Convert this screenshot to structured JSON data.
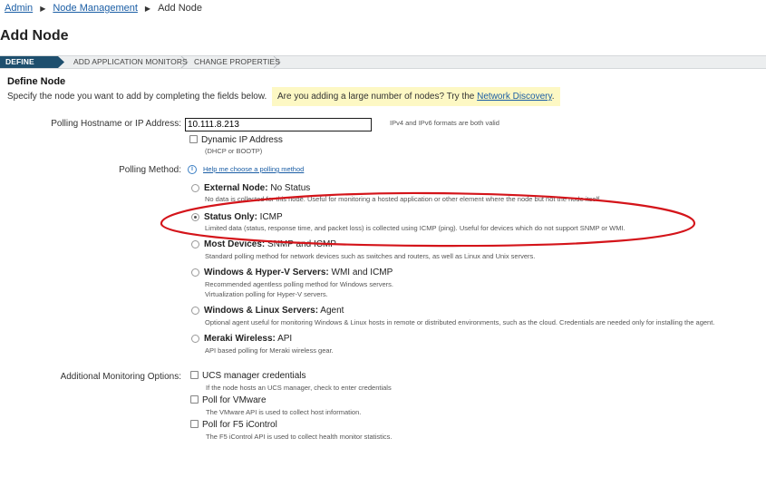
{
  "breadcrumb": {
    "item1": "Admin",
    "item2": "Node Management",
    "item3": "Add Node"
  },
  "page_title": "Add Node",
  "wizard_steps": [
    "DEFINE NODE",
    "ADD APPLICATION MONITORS",
    "CHANGE PROPERTIES"
  ],
  "section_title": "Define Node",
  "intro_text": "Specify the node you want to add by completing the fields below.",
  "hint": {
    "text": "Are you adding a large number of nodes? Try the",
    "link": "Network Discovery",
    "end": "."
  },
  "hostname": {
    "label": "Polling Hostname or IP Address:",
    "value": "10.111.8.213",
    "note": "IPv4 and IPv6 formats are both valid"
  },
  "dynamic_ip": {
    "label": "Dynamic IP Address",
    "sub": "(DHCP or BOOTP)"
  },
  "polling_method": {
    "label": "Polling Method:",
    "help_link": "Help me choose a polling method",
    "selected": "Status Only",
    "options": [
      {
        "name": "External Node:",
        "type": " No Status",
        "desc": [
          "No data is collected for this node. Useful for monitoring a hosted application or other element where the node but not the node itself."
        ]
      },
      {
        "name": "Status Only:",
        "type": " ICMP",
        "desc": [
          "Limited data (status, response time, and packet loss) is collected using ICMP (ping). Useful for devices which do not support SNMP or WMI."
        ]
      },
      {
        "name": "Most Devices:",
        "type": " SNMP and ICMP",
        "desc": [
          "Standard polling method for network devices such as switches and routers, as well as Linux and Unix servers."
        ]
      },
      {
        "name": "Windows & Hyper-V Servers:",
        "type": " WMI and ICMP",
        "desc": [
          "Recommended agentless polling method for Windows servers.",
          "Virtualization polling for Hyper-V servers."
        ]
      },
      {
        "name": "Windows & Linux Servers:",
        "type": " Agent",
        "desc": [
          "Optional agent useful for monitoring Windows & Linux hosts in remote or distributed environments, such as the cloud. Credentials are needed only for installing the agent."
        ]
      },
      {
        "name": "Meraki Wireless:",
        "type": " API",
        "desc": [
          "API based polling for Meraki wireless gear."
        ]
      }
    ]
  },
  "additional": {
    "label": "Additional Monitoring Options:",
    "options": [
      {
        "label": "UCS manager credentials",
        "desc": "If the node hosts an UCS manager, check to enter credentials"
      },
      {
        "label": "Poll for VMware",
        "desc": "The VMware API is used to collect host information."
      },
      {
        "label": "Poll for F5 iControl",
        "desc": "The F5 iControl API is used to collect health monitor statistics."
      }
    ]
  },
  "colors": {
    "wizard_active": "#1e4f6e",
    "hint_bg": "#fdf8c4",
    "annotation": "#d4141a",
    "link": "#1b5ea5"
  }
}
